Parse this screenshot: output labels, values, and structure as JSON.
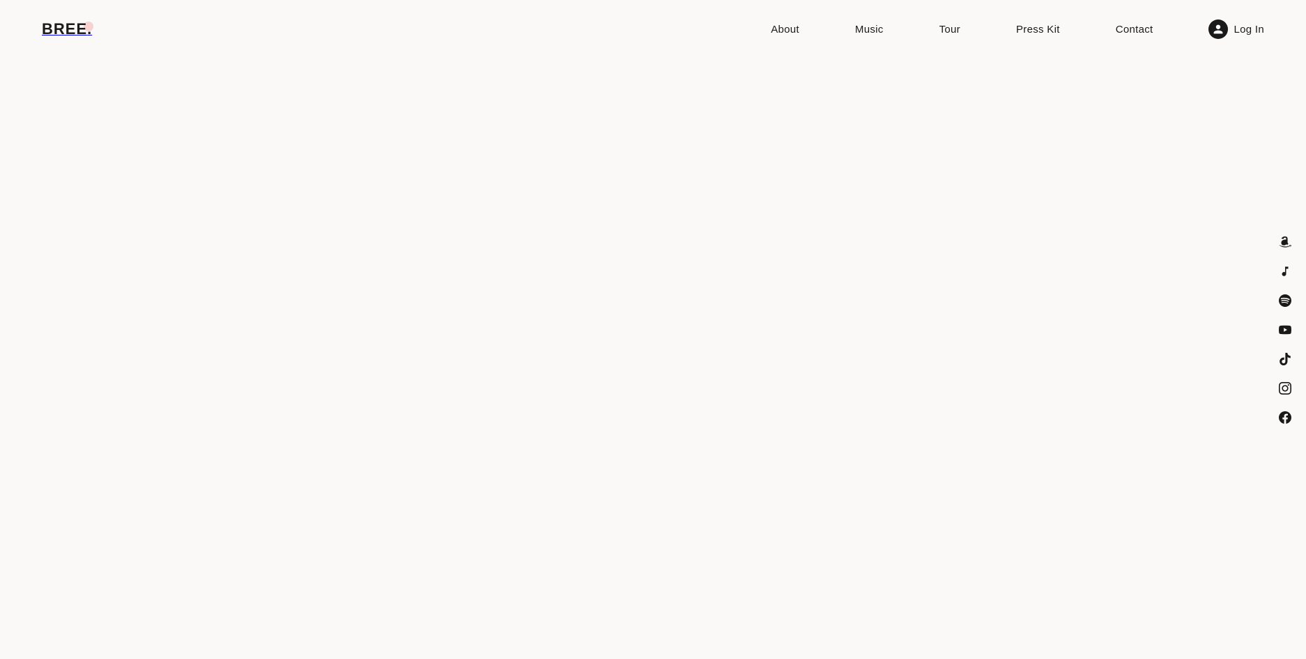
{
  "logo": {
    "text": "BREE",
    "dot": "."
  },
  "nav": {
    "items": [
      {
        "label": "About",
        "href": "#about"
      },
      {
        "label": "Music",
        "href": "#music"
      },
      {
        "label": "Tour",
        "href": "#tour"
      },
      {
        "label": "Press Kit",
        "href": "#presskit"
      },
      {
        "label": "Contact",
        "href": "#contact"
      }
    ],
    "login_label": "Log In"
  },
  "social": {
    "items": [
      {
        "name": "amazon-icon",
        "label": "Amazon Music"
      },
      {
        "name": "apple-music-icon",
        "label": "Apple Music"
      },
      {
        "name": "spotify-icon",
        "label": "Spotify"
      },
      {
        "name": "youtube-icon",
        "label": "YouTube"
      },
      {
        "name": "tiktok-icon",
        "label": "TikTok"
      },
      {
        "name": "instagram-icon",
        "label": "Instagram"
      },
      {
        "name": "facebook-icon",
        "label": "Facebook"
      }
    ]
  }
}
